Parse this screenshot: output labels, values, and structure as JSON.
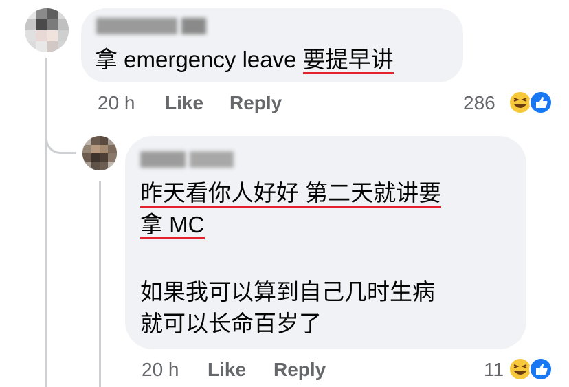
{
  "comment": {
    "text_prefix": "拿 emergency leave ",
    "text_highlight": "要提早讲",
    "time": "20 h",
    "like_label": "Like",
    "reply_label": "Reply",
    "reaction_count": "286",
    "reaction_icons": [
      "haha-icon",
      "like-icon"
    ]
  },
  "reply": {
    "line1": "昨天看你人好好 第二天就讲要",
    "line2": "拿 MC",
    "line3": "如果我可以算到自己几时生病",
    "line4": "就可以长命百岁了",
    "time": "20 h",
    "like_label": "Like",
    "reply_label": "Reply",
    "reaction_count": "11",
    "reaction_icons": [
      "haha-icon",
      "like-icon"
    ]
  },
  "colors": {
    "bubble": "#f0f2f5",
    "underline": "#e4222e",
    "meta": "#65676b",
    "like_blue": "#1877f2",
    "haha_yellow": "#f7c93a"
  }
}
